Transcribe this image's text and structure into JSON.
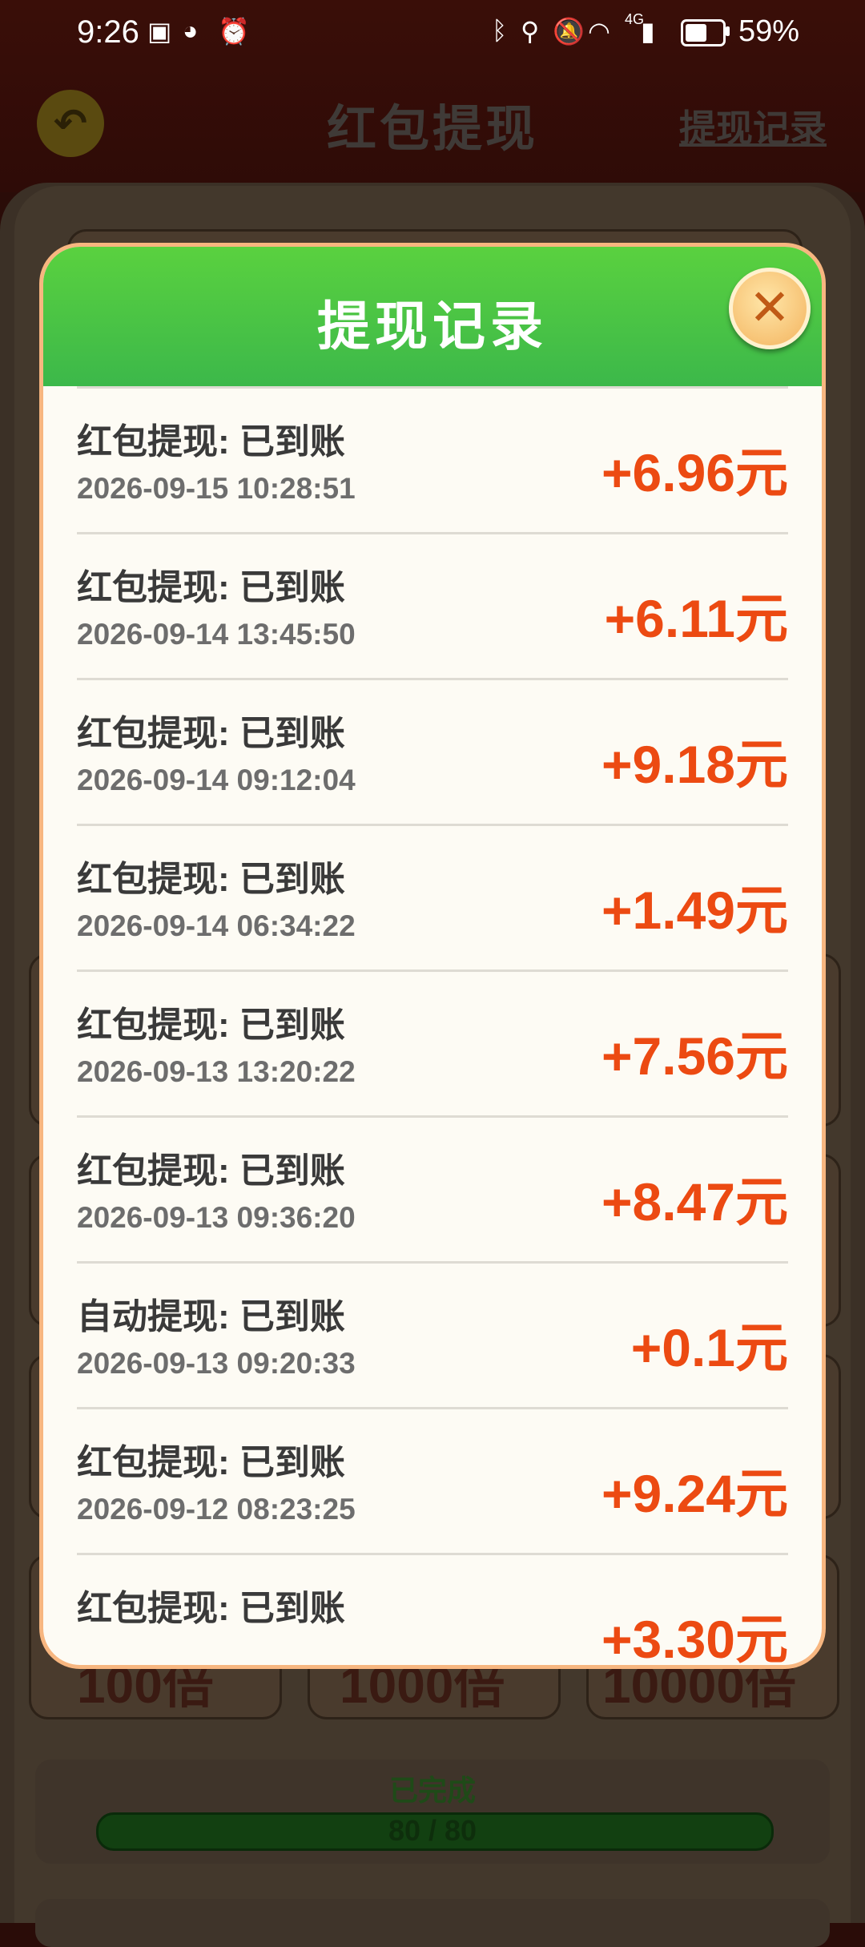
{
  "status_bar": {
    "time": "9:26",
    "battery": "59%",
    "battery_level": 0.59,
    "network": "4G"
  },
  "background": {
    "title": "红包提现",
    "record_link": "提现记录",
    "multipliers": [
      "100倍",
      "1000倍",
      "10000倍"
    ],
    "done_label": "已完成",
    "progress_text": "80 / 80",
    "progress": 1.0
  },
  "modal": {
    "title": "提现记录",
    "records": [
      {
        "label": "红包提现: 已到账",
        "time": "2026-09-15 10:28:51",
        "amount": "+6.96元"
      },
      {
        "label": "红包提现: 已到账",
        "time": "2026-09-14 13:45:50",
        "amount": "+6.11元"
      },
      {
        "label": "红包提现: 已到账",
        "time": "2026-09-14 09:12:04",
        "amount": "+9.18元"
      },
      {
        "label": "红包提现: 已到账",
        "time": "2026-09-14 06:34:22",
        "amount": "+1.49元"
      },
      {
        "label": "红包提现: 已到账",
        "time": "2026-09-13 13:20:22",
        "amount": "+7.56元"
      },
      {
        "label": "红包提现: 已到账",
        "time": "2026-09-13 09:36:20",
        "amount": "+8.47元"
      },
      {
        "label": "自动提现: 已到账",
        "time": "2026-09-13 09:20:33",
        "amount": "+0.1元"
      },
      {
        "label": "红包提现: 已到账",
        "time": "2026-09-12 08:23:25",
        "amount": "+9.24元"
      },
      {
        "label": "红包提现: 已到账",
        "time": "",
        "amount": "+3.30元"
      }
    ]
  },
  "colors": {
    "header_green": "#4cc946",
    "amount_orange": "#ec4a12",
    "close_button": "#f3b35e"
  }
}
